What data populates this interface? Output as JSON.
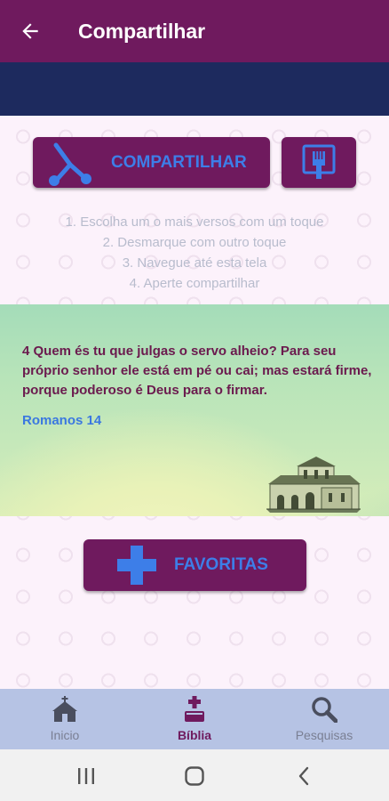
{
  "appbar": {
    "title": "Compartilhar",
    "back_icon": "arrow-left-icon"
  },
  "share": {
    "button_label": "COMPARTILHAR",
    "share_icon": "share-icon",
    "brush_icon": "brush-icon",
    "instructions": [
      "1. Escolha um o mais versos com um toque",
      "2. Desmarque com outro toque",
      "3. Navegue até esta tela",
      "4. Aperte compartilhar"
    ]
  },
  "verse": {
    "text": "4 Quem és tu que julgas o servo alheio? Para seu próprio senhor ele está em pé ou cai; mas estará firme, porque poderoso é Deus para o firmar.",
    "reference": "Romanos 14",
    "image_icon": "church-illustration"
  },
  "favorites": {
    "button_label": "FAVORITAS",
    "icon": "plus-icon"
  },
  "bottom_nav": {
    "items": [
      {
        "label": "Inicio",
        "icon": "church-icon",
        "active": false
      },
      {
        "label": "Bíblia",
        "icon": "bible-icon",
        "active": true
      },
      {
        "label": "Pesquisas",
        "icon": "search-icon",
        "active": false
      }
    ]
  },
  "system_nav": {
    "recents_icon": "recents-icon",
    "home_icon": "home-icon",
    "back_icon": "back-chevron-icon"
  },
  "colors": {
    "primary": "#6f1a5e",
    "accent": "#3d7ee8",
    "navy": "#1d2a5e",
    "nav_bg": "#b6c3e4"
  }
}
